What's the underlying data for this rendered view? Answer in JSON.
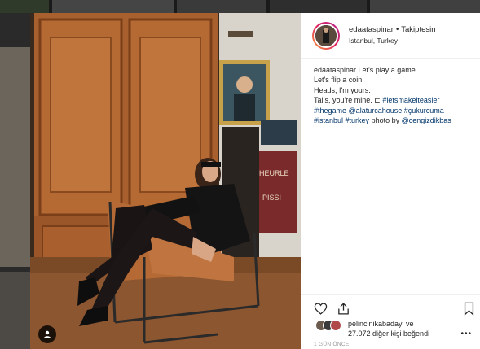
{
  "post": {
    "username": "edaataspinar",
    "separator": "•",
    "follow_label": "Takiptesin",
    "location": "Istanbul, Turkey",
    "caption": {
      "line1_user": "edaataspinar",
      "line1_text": " Let's play a game.",
      "line2": "Let's flip a coin.",
      "line3": "Heads, I'm yours.",
      "line4": "Tails, you're mine. ⊏",
      "line4_tag": "#letsmakeiteasier",
      "line5_tag1": "#thegame",
      "line5_tag2": "@alaturcahouse",
      "line5_tag3": "#çukurcuma",
      "line6_tag1": "#istanbul",
      "line6_tag2": "#turkey",
      "line6_text": " photo by ",
      "line6_tag3": "@cengizdikbas"
    },
    "likes": {
      "user": "pelincinikabadayi",
      "and": " ve",
      "count_text": "27.072 diğer kişi beğendi"
    },
    "time": "1 GÜN ÖNCE",
    "more_label": "•••"
  },
  "icons": {
    "like": "heart-icon",
    "share": "share-icon",
    "save": "bookmark-icon",
    "tagged_user": "user-icon"
  },
  "colors": {
    "link": "#003569",
    "text": "#262626",
    "muted": "#999999"
  }
}
